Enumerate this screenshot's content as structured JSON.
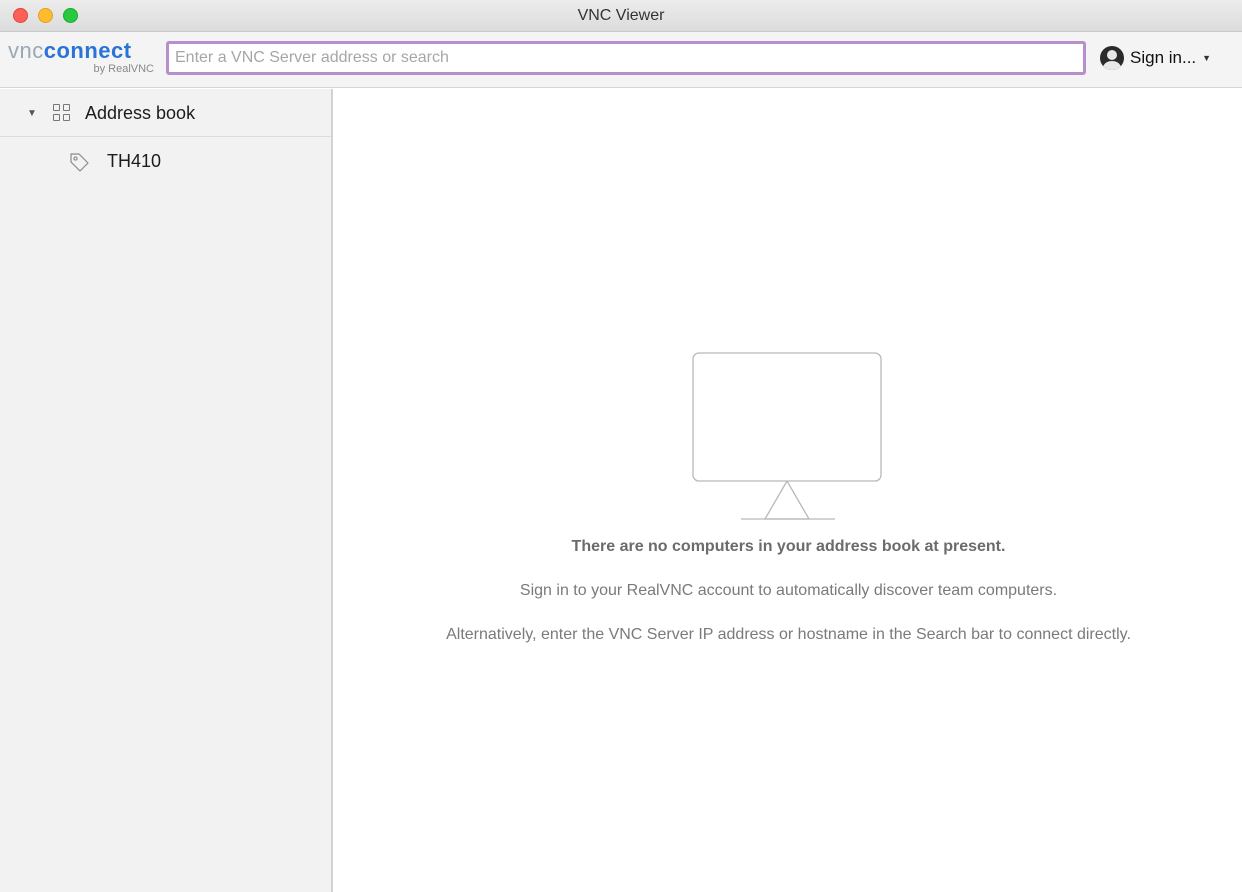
{
  "window": {
    "title": "VNC Viewer"
  },
  "toolbar": {
    "logo": {
      "word1": "vnc",
      "word2": "connect",
      "subtitle": "by RealVNC"
    },
    "search": {
      "placeholder": "Enter a VNC Server address or search",
      "value": ""
    },
    "signin": {
      "label": "Sign in...",
      "icon": "user-avatar-icon",
      "caret_icon": "caret-down-icon"
    }
  },
  "sidebar": {
    "header": {
      "label": "Address book",
      "icon": "grid-icon",
      "expanded": true
    },
    "items": [
      {
        "label": "TH410",
        "icon": "tag-icon"
      }
    ]
  },
  "main": {
    "empty_state": {
      "icon": "monitor-icon",
      "title": "There are no computers in your address book at present.",
      "line1": "Sign in to your RealVNC account to automatically discover team computers.",
      "line2": "Alternatively, enter the VNC Server IP address or hostname in the Search bar to connect directly."
    }
  },
  "colors": {
    "accent": "#2a74d8",
    "search_focus_border": "#b68fcc",
    "sidebar_bg": "#f2f2f2"
  }
}
